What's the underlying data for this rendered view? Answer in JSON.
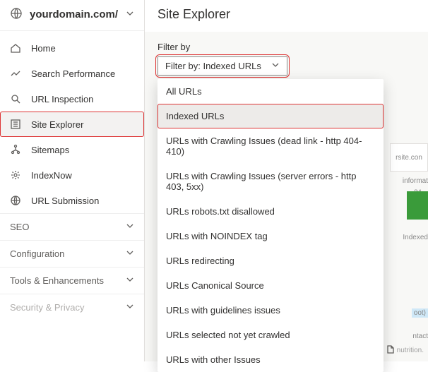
{
  "domain": "yourdomain.com/",
  "pageTitle": "Site Explorer",
  "nav": {
    "items": [
      {
        "label": "Home"
      },
      {
        "label": "Search Performance"
      },
      {
        "label": "URL Inspection"
      },
      {
        "label": "Site Explorer"
      },
      {
        "label": "Sitemaps"
      },
      {
        "label": "IndexNow"
      },
      {
        "label": "URL Submission"
      }
    ],
    "sections": [
      {
        "label": "SEO"
      },
      {
        "label": "Configuration"
      },
      {
        "label": "Tools & Enhancements"
      },
      {
        "label": "Security & Privacy"
      }
    ]
  },
  "filter": {
    "label": "Filter by",
    "button": "Filter by: Indexed URLs",
    "options": [
      "All URLs",
      "Indexed URLs",
      "URLs with Crawling Issues (dead link - http 404-410)",
      "URLs with Crawling Issues (server errors - http 403, 5xx)",
      "URLs robots.txt disallowed",
      "URLs with NOINDEX tag",
      "URLs redirecting",
      "URLs Canonical Source",
      "URLs with guidelines issues",
      "URLs selected not yet crawled",
      "URLs with other Issues"
    ],
    "selectedIndex": 1
  },
  "bg": {
    "siteText": "rsite.con",
    "info": "informat",
    "count": "31",
    "indexed": "Indexed",
    "root": "oot)",
    "contact": "ntact",
    "nutrition": "nutrition."
  }
}
